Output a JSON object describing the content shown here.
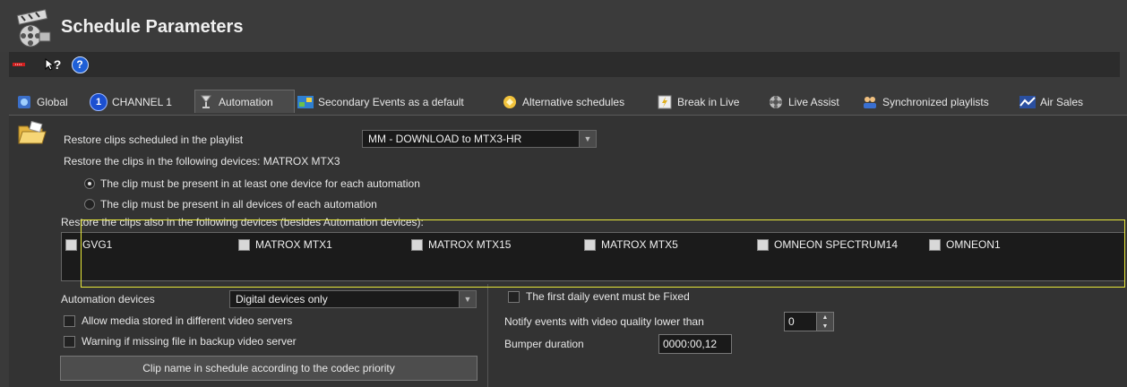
{
  "window": {
    "title": "Schedule Parameters"
  },
  "toolbar": {
    "help_label": "?",
    "help_circle": "?"
  },
  "tabs": [
    {
      "label": "Global",
      "icon": "globe-icon"
    },
    {
      "label": "CHANNEL 1",
      "icon": "channel-number-icon",
      "badge": "1"
    },
    {
      "label": "Automation",
      "icon": "automation-icon",
      "active": true
    },
    {
      "label": "Secondary Events as a default",
      "icon": "secondary-events-icon"
    },
    {
      "label": "Alternative schedules",
      "icon": "alternative-schedules-icon"
    },
    {
      "label": "Break in Live",
      "icon": "break-in-live-icon"
    },
    {
      "label": "Live Assist",
      "icon": "live-assist-icon"
    },
    {
      "label": "Synchronized playlists",
      "icon": "synchronized-playlists-icon"
    },
    {
      "label": "Air Sales",
      "icon": "air-sales-icon"
    }
  ],
  "automation": {
    "restore_label": "Restore clips scheduled in the playlist",
    "restore_value": "MM - DOWNLOAD to MTX3-HR",
    "restore_devices_label": "Restore the clips in the following devices: MATROX MTX3",
    "radio_at_least_one": "The clip must be present in at least one device for each automation",
    "radio_all_devices": "The clip must be present in all devices of each automation",
    "also_devices_label": "Restore the clips also in the following devices (besides Automation devices):",
    "devices": [
      "GVG1",
      "MATROX MTX1",
      "MATROX MTX15",
      "MATROX MTX5",
      "OMNEON SPECTRUM14",
      "OMNEON1"
    ],
    "automation_devices_label": "Automation devices",
    "automation_devices_value": "Digital devices only",
    "allow_media_label": "Allow media stored in different video servers",
    "warning_missing_label": "Warning if missing file in backup video server",
    "clip_name_button": "Clip name in schedule according to the codec priority",
    "first_daily_fixed_label": "The first daily event must be Fixed",
    "notify_quality_label": "Notify events with video quality lower than",
    "notify_quality_value": "0",
    "bumper_duration_label": "Bumper duration",
    "bumper_duration_value": "0000:00,12"
  },
  "colors": {
    "highlight": "#e8e83a",
    "accent_blue": "#1e5fd6"
  }
}
